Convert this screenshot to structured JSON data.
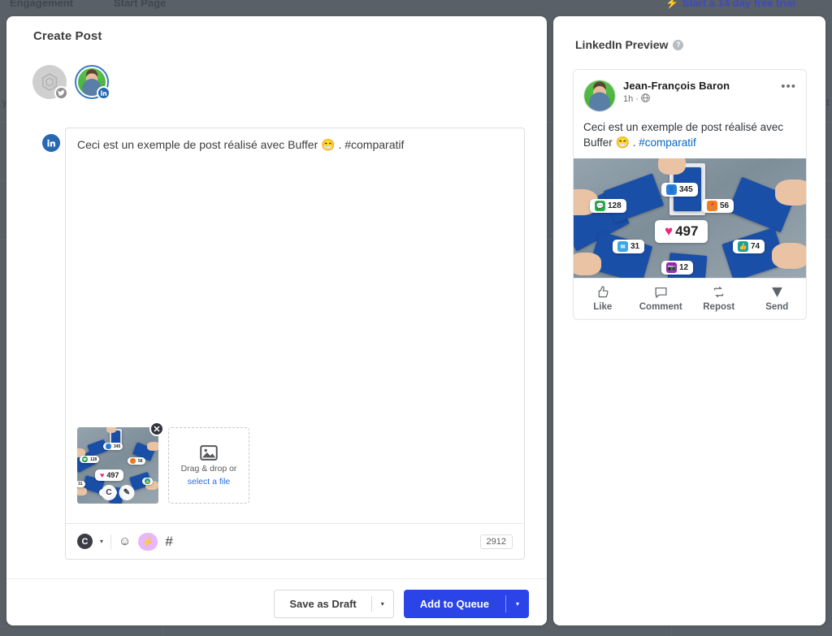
{
  "background": {
    "nav_items": [
      "Engagement",
      "Start Page"
    ],
    "trial_cta": "Start a 14 day free trial",
    "bolt_icon": "bolt-icon",
    "left_fragment": "y",
    "right_fragment": "at"
  },
  "compose": {
    "title": "Create Post",
    "accounts": [
      {
        "name": "twitter-account",
        "network": "twitter",
        "badge_icon": "twitter-icon",
        "selected": false
      },
      {
        "name": "linkedin-account",
        "network": "linkedin",
        "badge_icon": "linkedin-icon",
        "selected": true
      }
    ],
    "channel_icon": "linkedin-icon",
    "channel_icon_label": "in",
    "editor": {
      "text_before_emoji": "Ceci est un exemple de post réalisé avec Buffer ",
      "emoji": "😁",
      "text_after_emoji": " . #comparatif",
      "full_text": "Ceci est un exemple de post réalisé avec Buffer 😁 . #comparatif"
    },
    "media": {
      "thumbnail_alt": "social-media-engagement-photo",
      "remove_icon": "close-icon",
      "remove_label": "✕",
      "tools": [
        {
          "name": "crop-tool",
          "label": "C"
        },
        {
          "name": "edit-tool",
          "label": "✎"
        }
      ],
      "dropzone": {
        "icon": "image-icon",
        "line1": "Drag & drop or",
        "line2": "select a file"
      }
    },
    "toolbar": {
      "customize_label": "C",
      "customize_icon": "customize-icon",
      "caret_icon": "chevron-down-icon",
      "caret_label": "▾",
      "emoji_icon": "emoji-icon",
      "emoji_label": "☺",
      "ai_icon": "ai-bolt-icon",
      "ai_label": "⚡",
      "hashtag_icon": "hashtag-icon",
      "hashtag_label": "#",
      "char_count": "2912"
    },
    "footer": {
      "draft_label": "Save as Draft",
      "draft_caret": "▾",
      "queue_label": "Add to Queue",
      "queue_caret": "▾",
      "queue_color": "#2b44e8"
    }
  },
  "preview": {
    "title": "LinkedIn Preview",
    "help_icon": "help-icon",
    "help_label": "?",
    "post": {
      "author": "Jean-François Baron",
      "time": "1h",
      "separator": "·",
      "visibility_icon": "globe-icon",
      "visibility_label": "🌐",
      "more_icon": "more-options-icon",
      "more_label": "•••",
      "text_before_emoji": "Ceci est un exemple de post réalisé avec Buffer ",
      "emoji": "😁",
      "text_middle": " . ",
      "hashtag": "#comparatif",
      "image_alt": "social-media-engagement-photo"
    },
    "actions": [
      {
        "name": "like-action",
        "icon": "thumbs-up-icon",
        "label": "Like"
      },
      {
        "name": "comment-action",
        "icon": "comment-icon",
        "label": "Comment"
      },
      {
        "name": "repost-action",
        "icon": "repost-icon",
        "label": "Repost"
      },
      {
        "name": "send-action",
        "icon": "send-icon",
        "label": "Send"
      }
    ]
  },
  "photo_badges": [
    {
      "name": "followers-badge",
      "icon": "person-icon",
      "value": "345",
      "color": "#2f7fd6"
    },
    {
      "name": "comments-badge",
      "icon": "chat-icon",
      "value": "128",
      "color": "#22b14c"
    },
    {
      "name": "location-badge",
      "icon": "pin-icon",
      "value": "56",
      "color": "#f07d1e"
    },
    {
      "name": "likes-badge",
      "icon": "heart-icon",
      "value": "497",
      "color": "#ec2a7b"
    },
    {
      "name": "mail-badge",
      "icon": "mail-icon",
      "value": "31",
      "color": "#3ba7e8"
    },
    {
      "name": "thumbsup-badge",
      "icon": "thumbs-up-icon",
      "value": "74",
      "color": "#18a0a0"
    },
    {
      "name": "camera-badge",
      "icon": "camera-icon",
      "value": "12",
      "color": "#a020b8"
    }
  ]
}
